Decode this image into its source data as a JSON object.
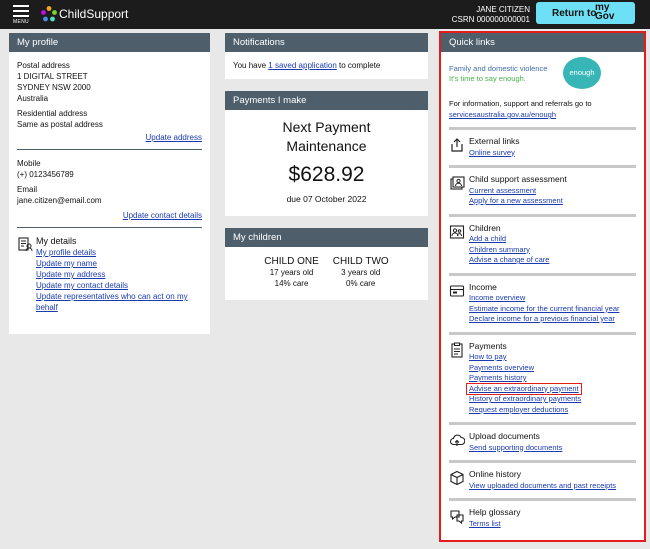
{
  "header": {
    "menu_label": "MENU",
    "brand": "ChildSupport",
    "user_name": "JANE CITIZEN",
    "csrn": "CSRN 000000000001",
    "mygov_return": "Return to",
    "mygov_my": "my",
    "mygov_gov": "Gov"
  },
  "profile": {
    "title": "My profile",
    "postal_label": "Postal address",
    "postal_lines": [
      "1 DIGITAL STREET",
      "SYDNEY NSW 2000",
      "Australia"
    ],
    "residential_label": "Residential address",
    "residential_value": "Same as postal address",
    "update_address": "Update address",
    "mobile_label": "Mobile",
    "mobile_value": "(+) 0123456789",
    "email_label": "Email",
    "email_value": "jane.citizen@email.com",
    "update_contact": "Update contact details",
    "my_details_title": "My details",
    "my_details_links": [
      "My profile details",
      "Update my name",
      "Update my address",
      "Update my contact details",
      "Update representatives who can act on my behalf"
    ]
  },
  "notifications": {
    "title": "Notifications",
    "text_before": "You have ",
    "link": "1 saved application",
    "text_after": " to complete"
  },
  "payments": {
    "title": "Payments I make",
    "heading_line1": "Next Payment",
    "heading_line2": "Maintenance",
    "amount": "$628.92",
    "due": "due 07 October 2022"
  },
  "children": {
    "title": "My children",
    "list": [
      {
        "name": "CHILD ONE",
        "age": "17 years old",
        "care": "14% care"
      },
      {
        "name": "CHILD TWO",
        "age": "3 years old",
        "care": "0% care"
      }
    ]
  },
  "quicklinks": {
    "title": "Quick links",
    "banner_line1": "Family and domestic violence",
    "banner_line2": "It's time to say enough.",
    "banner_logo": "enough",
    "intro": "For information, support and referrals go to",
    "intro_link": "servicesaustralia.gov.au/enough",
    "sections": [
      {
        "icon": "external-link-icon",
        "title": "External links",
        "links": [
          "Online survey"
        ]
      },
      {
        "icon": "assessment-icon",
        "title": "Child support assessment",
        "links": [
          "Current assessment",
          "Apply for a new assessment"
        ]
      },
      {
        "icon": "children-icon",
        "title": "Children",
        "links": [
          "Add a child",
          "Children summary",
          "Advise a change of care"
        ]
      },
      {
        "icon": "income-icon",
        "title": "Income",
        "links": [
          "Income overview",
          "Estimate income for the current financial year",
          "Declare income for a previous financial year"
        ]
      },
      {
        "icon": "payments-icon",
        "title": "Payments",
        "links": [
          "How to pay",
          "Payments overview",
          "Payments history",
          "Advise an extraordinary payment",
          "History of extraordinary payments",
          "Request employer deductions"
        ],
        "highlight": 3
      },
      {
        "icon": "upload-icon",
        "title": "Upload documents",
        "links": [
          "Send supporting documents"
        ]
      },
      {
        "icon": "online-history-icon",
        "title": "Online history",
        "links": [
          "View uploaded documents and past receipts"
        ]
      },
      {
        "icon": "help-glossary-icon",
        "title": "Help glossary",
        "links": [
          "Terms list"
        ]
      }
    ]
  },
  "colors": {
    "header_bg": "#1c1c1c",
    "panel_header": "#4e5e6b",
    "mygov_button": "#6ee0f5",
    "link": "#1a3bb0",
    "highlight": "#e41c1c"
  }
}
